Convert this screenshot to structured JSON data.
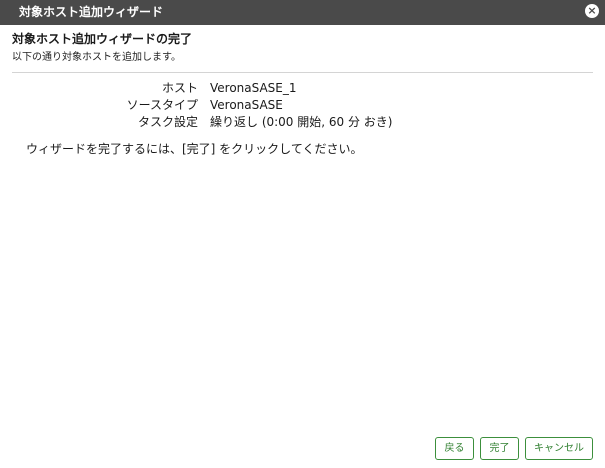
{
  "window": {
    "title": "対象ホスト追加ウィザード",
    "close_glyph": "×"
  },
  "header": {
    "heading": "対象ホスト追加ウィザードの完了",
    "subheading": "以下の通り対象ホストを追加します。"
  },
  "summary": [
    {
      "label": "ホスト",
      "value": "VeronaSASE_1"
    },
    {
      "label": "ソースタイプ",
      "value": "VeronaSASE"
    },
    {
      "label": "タスク設定",
      "value": "繰り返し (0:00 開始, 60 分 おき)"
    }
  ],
  "instruction": "ウィザードを完了するには、[完了] をクリックしてください。",
  "buttons": {
    "back": "戻る",
    "finish": "完了",
    "cancel": "キャンセル"
  },
  "colors": {
    "titlebar": "#4a4a4a",
    "button_border": "#3c8f3c",
    "button_text": "#2f7f2f"
  }
}
